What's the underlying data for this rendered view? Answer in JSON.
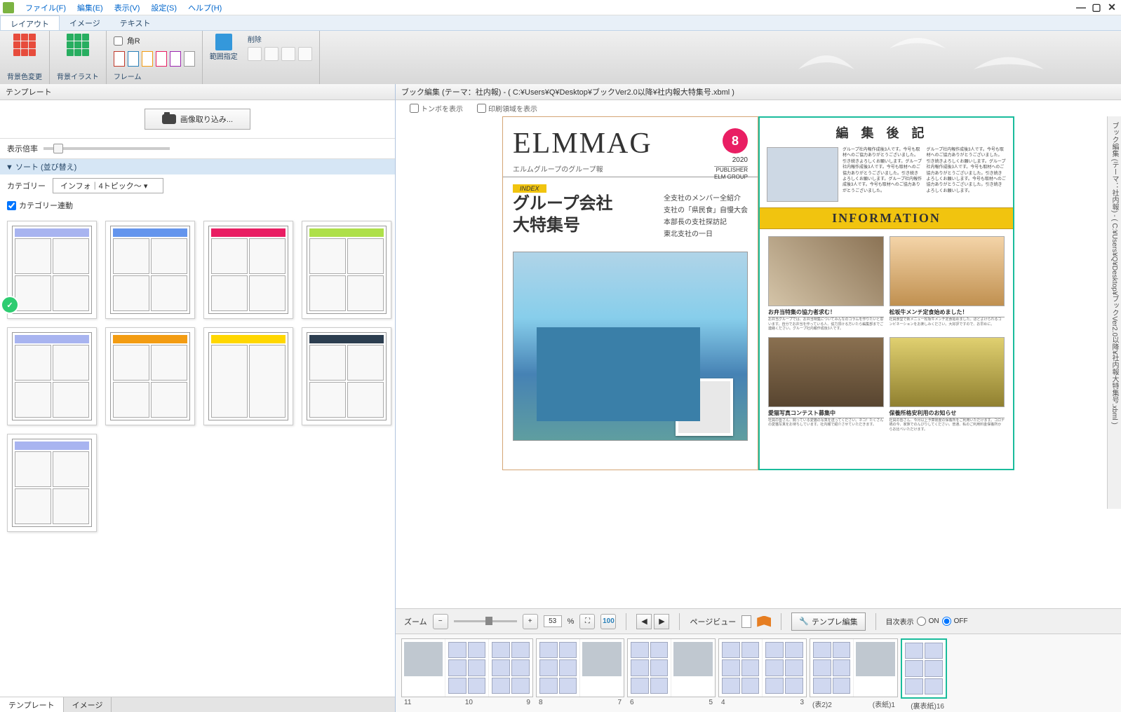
{
  "menu": {
    "file": "ファイル(F)",
    "edit": "編集(E)",
    "view": "表示(V)",
    "settings": "設定(S)",
    "help": "ヘルプ(H)"
  },
  "ribbon_tabs": {
    "layout": "レイアウト",
    "image": "イメージ",
    "text": "テキスト"
  },
  "ribbon": {
    "bg_color": "背景色変更",
    "bg_illust": "背景イラスト",
    "corner_r": "角R",
    "frame": "フレーム",
    "delete": "削除",
    "range": "範囲指定"
  },
  "left": {
    "title": "テンプレート",
    "import": "画像取り込み...",
    "zoom_label": "表示倍率",
    "sort": "▼ ソート (並び替え)",
    "category_label": "カテゴリー",
    "category_value": "インフォ｜4トピック〜",
    "category_link": "カテゴリー連動",
    "footer_template": "テンプレート",
    "footer_image": "イメージ"
  },
  "right": {
    "title": "ブック編集 (テーマ：社内報) - ( C:¥Users¥Q¥Desktop¥ブックVer2.0以降¥社内報大特集号.xbml )",
    "opt_trim": "トンボを表示",
    "opt_print": "印刷領域を表示",
    "side_tab": "ブック編集 (テーマ：社内報) - ( C:¥Users¥Q¥Desktop¥ブックVer2.0以降¥社内報大特集号.xbml )"
  },
  "magazine": {
    "title": "ELMMAG",
    "subtitle": "エルムグループのグループ報",
    "month": "8",
    "year": "2020",
    "pub1": "PUBLISHER",
    "pub2": "ELM GROUP",
    "index_label": "INDEX",
    "index_title": "グループ会社\n大特集号",
    "index_items": [
      "全支社のメンバー全紹介",
      "支社の「県民食」自慢大会",
      "本部長の支社探訪記",
      "東北支社の一日"
    ]
  },
  "hensyu": {
    "title": "編集後記",
    "body": "グループ社内報作成後3人です。今号も取材へのご協力ありがとうございました。引き続きよろしくお願いします。グループ社内報作成後3人です。今号も取材へのご協力ありがとうございました。引き続きよろしくお願いします。グループ社内報作成後3人です。今号も取材へのご協力ありがとうございました。",
    "body2": "グループ社内報作成後3人です。今号も取材へのご協力ありがとうございました。引き続きよろしくお願いします。グループ社内報作成後3人です。今号も取材へのご協力ありがとうございました。引き続きよろしくお願いします。今号も取材へのご協力ありがとうございました。引き続きよろしくお願いします。"
  },
  "info": {
    "banner": "INFORMATION",
    "cards": [
      {
        "title": "お弁当特集の協力者求む！",
        "desc": "お弁当グループでは、お弁当特集についてみんなのコラムを作りたいと思います。自分でお弁当を作っている人、協力頂ける方いたら編集部までご連絡ください。グループ社内報作成後3人です。"
      },
      {
        "title": "松坂牛メンチ定食始めました！",
        "desc": "社員食堂で新メニュー松坂牛メンチ定食始めました。ほどよけられるコンビネーションをお楽しみください。大好評ですので、お早めに。"
      },
      {
        "title": "愛猫写真コンテスト募集中",
        "desc": "社員の皆さん、飼っている愛猫の写真を送ってください。ネコ！たくさんの愛猫写真をお待ちしています。社内報で紹介させていただきます。"
      },
      {
        "title": "保養所格安利用のお知らせ",
        "desc": "社員の皆さん、今月以上予算限度の保養所をご利用いただけます。コロナ禍の今、家族でのんびりしてください。普通、私のご利用料金保養所からお比べいただけます。"
      }
    ]
  },
  "zoombar": {
    "zoom": "ズーム",
    "value": "53",
    "percent": "%",
    "pageview": "ページビュー",
    "tpl_edit": "テンプレ編集",
    "toc": "目次表示",
    "on": "ON",
    "off": "OFF"
  },
  "filmstrip": [
    {
      "l": "11",
      "r": "10",
      "cap_r": "9"
    },
    {
      "l": "8",
      "r": "7"
    },
    {
      "l": "6",
      "r": "5"
    },
    {
      "l": "4",
      "r": "3"
    },
    {
      "l": "(表2)2",
      "r": "(表紙)1"
    },
    {
      "l": "",
      "r": "(裏表紙)16"
    }
  ]
}
